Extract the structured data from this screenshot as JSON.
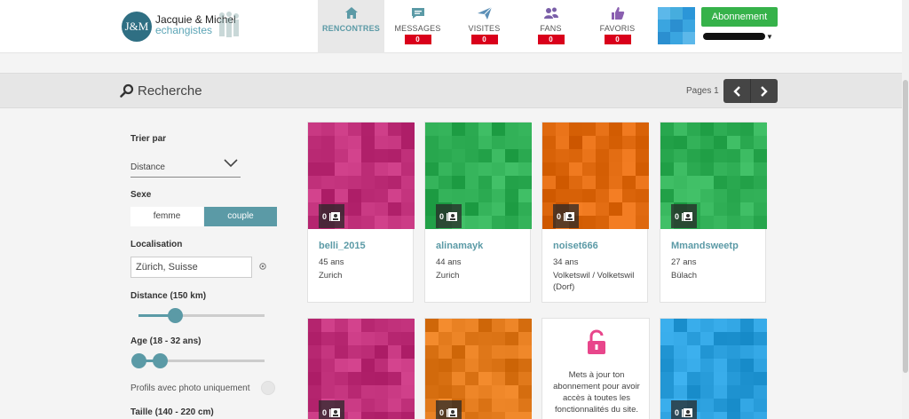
{
  "header": {
    "logo_initials": "J&M",
    "logo_name": "Jacquie & Michel",
    "logo_sub": "echangistes",
    "nav": [
      {
        "label": "RENCONTRES",
        "icon": "home-icon",
        "badge": null,
        "active": true
      },
      {
        "label": "MESSAGES",
        "icon": "chat-icon",
        "badge": "0",
        "active": false
      },
      {
        "label": "VISITES",
        "icon": "send-icon",
        "badge": "0",
        "active": false
      },
      {
        "label": "FANS",
        "icon": "people-icon",
        "badge": "0",
        "active": false
      },
      {
        "label": "FAVORIS",
        "icon": "thumbs-up-icon",
        "badge": "0",
        "active": false
      }
    ],
    "subscribe_label": "Abonnement"
  },
  "search": {
    "title": "Recherche",
    "pages_label": "Pages 1"
  },
  "filters": {
    "sort_label": "Trier par",
    "sort_value": "Distance",
    "sex_label": "Sexe",
    "sex_options": [
      "femme",
      "couple"
    ],
    "sex_selected": "couple",
    "location_label": "Localisation",
    "location_value": "Zürich, Suisse",
    "distance_label": "Distance (150 km)",
    "distance_value": 150,
    "age_label": "Age (18 - 32 ans)",
    "age_min": 18,
    "age_max": 32,
    "photo_only_label": "Profils avec photo uniquement",
    "height_label": "Taille (140 - 220 cm)"
  },
  "profiles": [
    {
      "name": "belli_2015",
      "age": "45 ans",
      "city": "Zurich",
      "photos": "0",
      "color": "#c0307a"
    },
    {
      "name": "alinamayk",
      "age": "44 ans",
      "city": "Zurich",
      "photos": "0",
      "color": "#2fae55"
    },
    {
      "name": "noiset666",
      "age": "34 ans",
      "city": "Volketswil / Volketswil (Dorf)",
      "photos": "0",
      "color": "#e06a10"
    },
    {
      "name": "Mmandsweetp",
      "age": "27 ans",
      "city": "Bülach",
      "photos": "0",
      "color": "#2fae55"
    },
    {
      "name": "",
      "age": "",
      "city": "",
      "photos": "0",
      "color": "#c0307a"
    },
    {
      "name": "",
      "age": "",
      "city": "",
      "photos": "0",
      "color": "#e0781a"
    },
    {
      "name": "",
      "age": "",
      "city": "",
      "photos": "0",
      "color": "#2a9edc"
    }
  ],
  "promo": {
    "text": "Mets à jour ton abonnement pour avoir accès à toutes les fonctionnalités du site."
  }
}
